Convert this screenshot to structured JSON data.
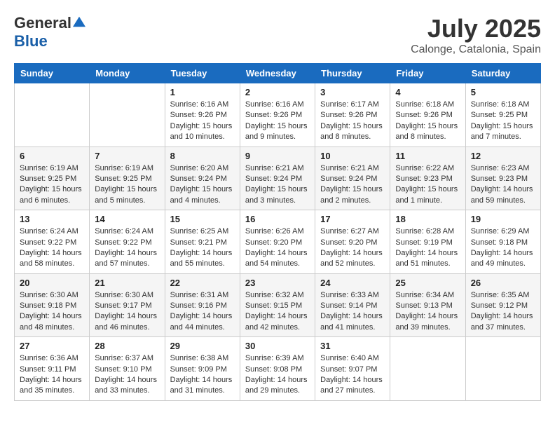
{
  "header": {
    "logo_general": "General",
    "logo_blue": "Blue",
    "month_year": "July 2025",
    "location": "Calonge, Catalonia, Spain"
  },
  "weekdays": [
    "Sunday",
    "Monday",
    "Tuesday",
    "Wednesday",
    "Thursday",
    "Friday",
    "Saturday"
  ],
  "weeks": [
    [
      {
        "day": "",
        "info": ""
      },
      {
        "day": "",
        "info": ""
      },
      {
        "day": "1",
        "info": "Sunrise: 6:16 AM\nSunset: 9:26 PM\nDaylight: 15 hours and 10 minutes."
      },
      {
        "day": "2",
        "info": "Sunrise: 6:16 AM\nSunset: 9:26 PM\nDaylight: 15 hours and 9 minutes."
      },
      {
        "day": "3",
        "info": "Sunrise: 6:17 AM\nSunset: 9:26 PM\nDaylight: 15 hours and 8 minutes."
      },
      {
        "day": "4",
        "info": "Sunrise: 6:18 AM\nSunset: 9:26 PM\nDaylight: 15 hours and 8 minutes."
      },
      {
        "day": "5",
        "info": "Sunrise: 6:18 AM\nSunset: 9:25 PM\nDaylight: 15 hours and 7 minutes."
      }
    ],
    [
      {
        "day": "6",
        "info": "Sunrise: 6:19 AM\nSunset: 9:25 PM\nDaylight: 15 hours and 6 minutes."
      },
      {
        "day": "7",
        "info": "Sunrise: 6:19 AM\nSunset: 9:25 PM\nDaylight: 15 hours and 5 minutes."
      },
      {
        "day": "8",
        "info": "Sunrise: 6:20 AM\nSunset: 9:24 PM\nDaylight: 15 hours and 4 minutes."
      },
      {
        "day": "9",
        "info": "Sunrise: 6:21 AM\nSunset: 9:24 PM\nDaylight: 15 hours and 3 minutes."
      },
      {
        "day": "10",
        "info": "Sunrise: 6:21 AM\nSunset: 9:24 PM\nDaylight: 15 hours and 2 minutes."
      },
      {
        "day": "11",
        "info": "Sunrise: 6:22 AM\nSunset: 9:23 PM\nDaylight: 15 hours and 1 minute."
      },
      {
        "day": "12",
        "info": "Sunrise: 6:23 AM\nSunset: 9:23 PM\nDaylight: 14 hours and 59 minutes."
      }
    ],
    [
      {
        "day": "13",
        "info": "Sunrise: 6:24 AM\nSunset: 9:22 PM\nDaylight: 14 hours and 58 minutes."
      },
      {
        "day": "14",
        "info": "Sunrise: 6:24 AM\nSunset: 9:22 PM\nDaylight: 14 hours and 57 minutes."
      },
      {
        "day": "15",
        "info": "Sunrise: 6:25 AM\nSunset: 9:21 PM\nDaylight: 14 hours and 55 minutes."
      },
      {
        "day": "16",
        "info": "Sunrise: 6:26 AM\nSunset: 9:20 PM\nDaylight: 14 hours and 54 minutes."
      },
      {
        "day": "17",
        "info": "Sunrise: 6:27 AM\nSunset: 9:20 PM\nDaylight: 14 hours and 52 minutes."
      },
      {
        "day": "18",
        "info": "Sunrise: 6:28 AM\nSunset: 9:19 PM\nDaylight: 14 hours and 51 minutes."
      },
      {
        "day": "19",
        "info": "Sunrise: 6:29 AM\nSunset: 9:18 PM\nDaylight: 14 hours and 49 minutes."
      }
    ],
    [
      {
        "day": "20",
        "info": "Sunrise: 6:30 AM\nSunset: 9:18 PM\nDaylight: 14 hours and 48 minutes."
      },
      {
        "day": "21",
        "info": "Sunrise: 6:30 AM\nSunset: 9:17 PM\nDaylight: 14 hours and 46 minutes."
      },
      {
        "day": "22",
        "info": "Sunrise: 6:31 AM\nSunset: 9:16 PM\nDaylight: 14 hours and 44 minutes."
      },
      {
        "day": "23",
        "info": "Sunrise: 6:32 AM\nSunset: 9:15 PM\nDaylight: 14 hours and 42 minutes."
      },
      {
        "day": "24",
        "info": "Sunrise: 6:33 AM\nSunset: 9:14 PM\nDaylight: 14 hours and 41 minutes."
      },
      {
        "day": "25",
        "info": "Sunrise: 6:34 AM\nSunset: 9:13 PM\nDaylight: 14 hours and 39 minutes."
      },
      {
        "day": "26",
        "info": "Sunrise: 6:35 AM\nSunset: 9:12 PM\nDaylight: 14 hours and 37 minutes."
      }
    ],
    [
      {
        "day": "27",
        "info": "Sunrise: 6:36 AM\nSunset: 9:11 PM\nDaylight: 14 hours and 35 minutes."
      },
      {
        "day": "28",
        "info": "Sunrise: 6:37 AM\nSunset: 9:10 PM\nDaylight: 14 hours and 33 minutes."
      },
      {
        "day": "29",
        "info": "Sunrise: 6:38 AM\nSunset: 9:09 PM\nDaylight: 14 hours and 31 minutes."
      },
      {
        "day": "30",
        "info": "Sunrise: 6:39 AM\nSunset: 9:08 PM\nDaylight: 14 hours and 29 minutes."
      },
      {
        "day": "31",
        "info": "Sunrise: 6:40 AM\nSunset: 9:07 PM\nDaylight: 14 hours and 27 minutes."
      },
      {
        "day": "",
        "info": ""
      },
      {
        "day": "",
        "info": ""
      }
    ]
  ]
}
